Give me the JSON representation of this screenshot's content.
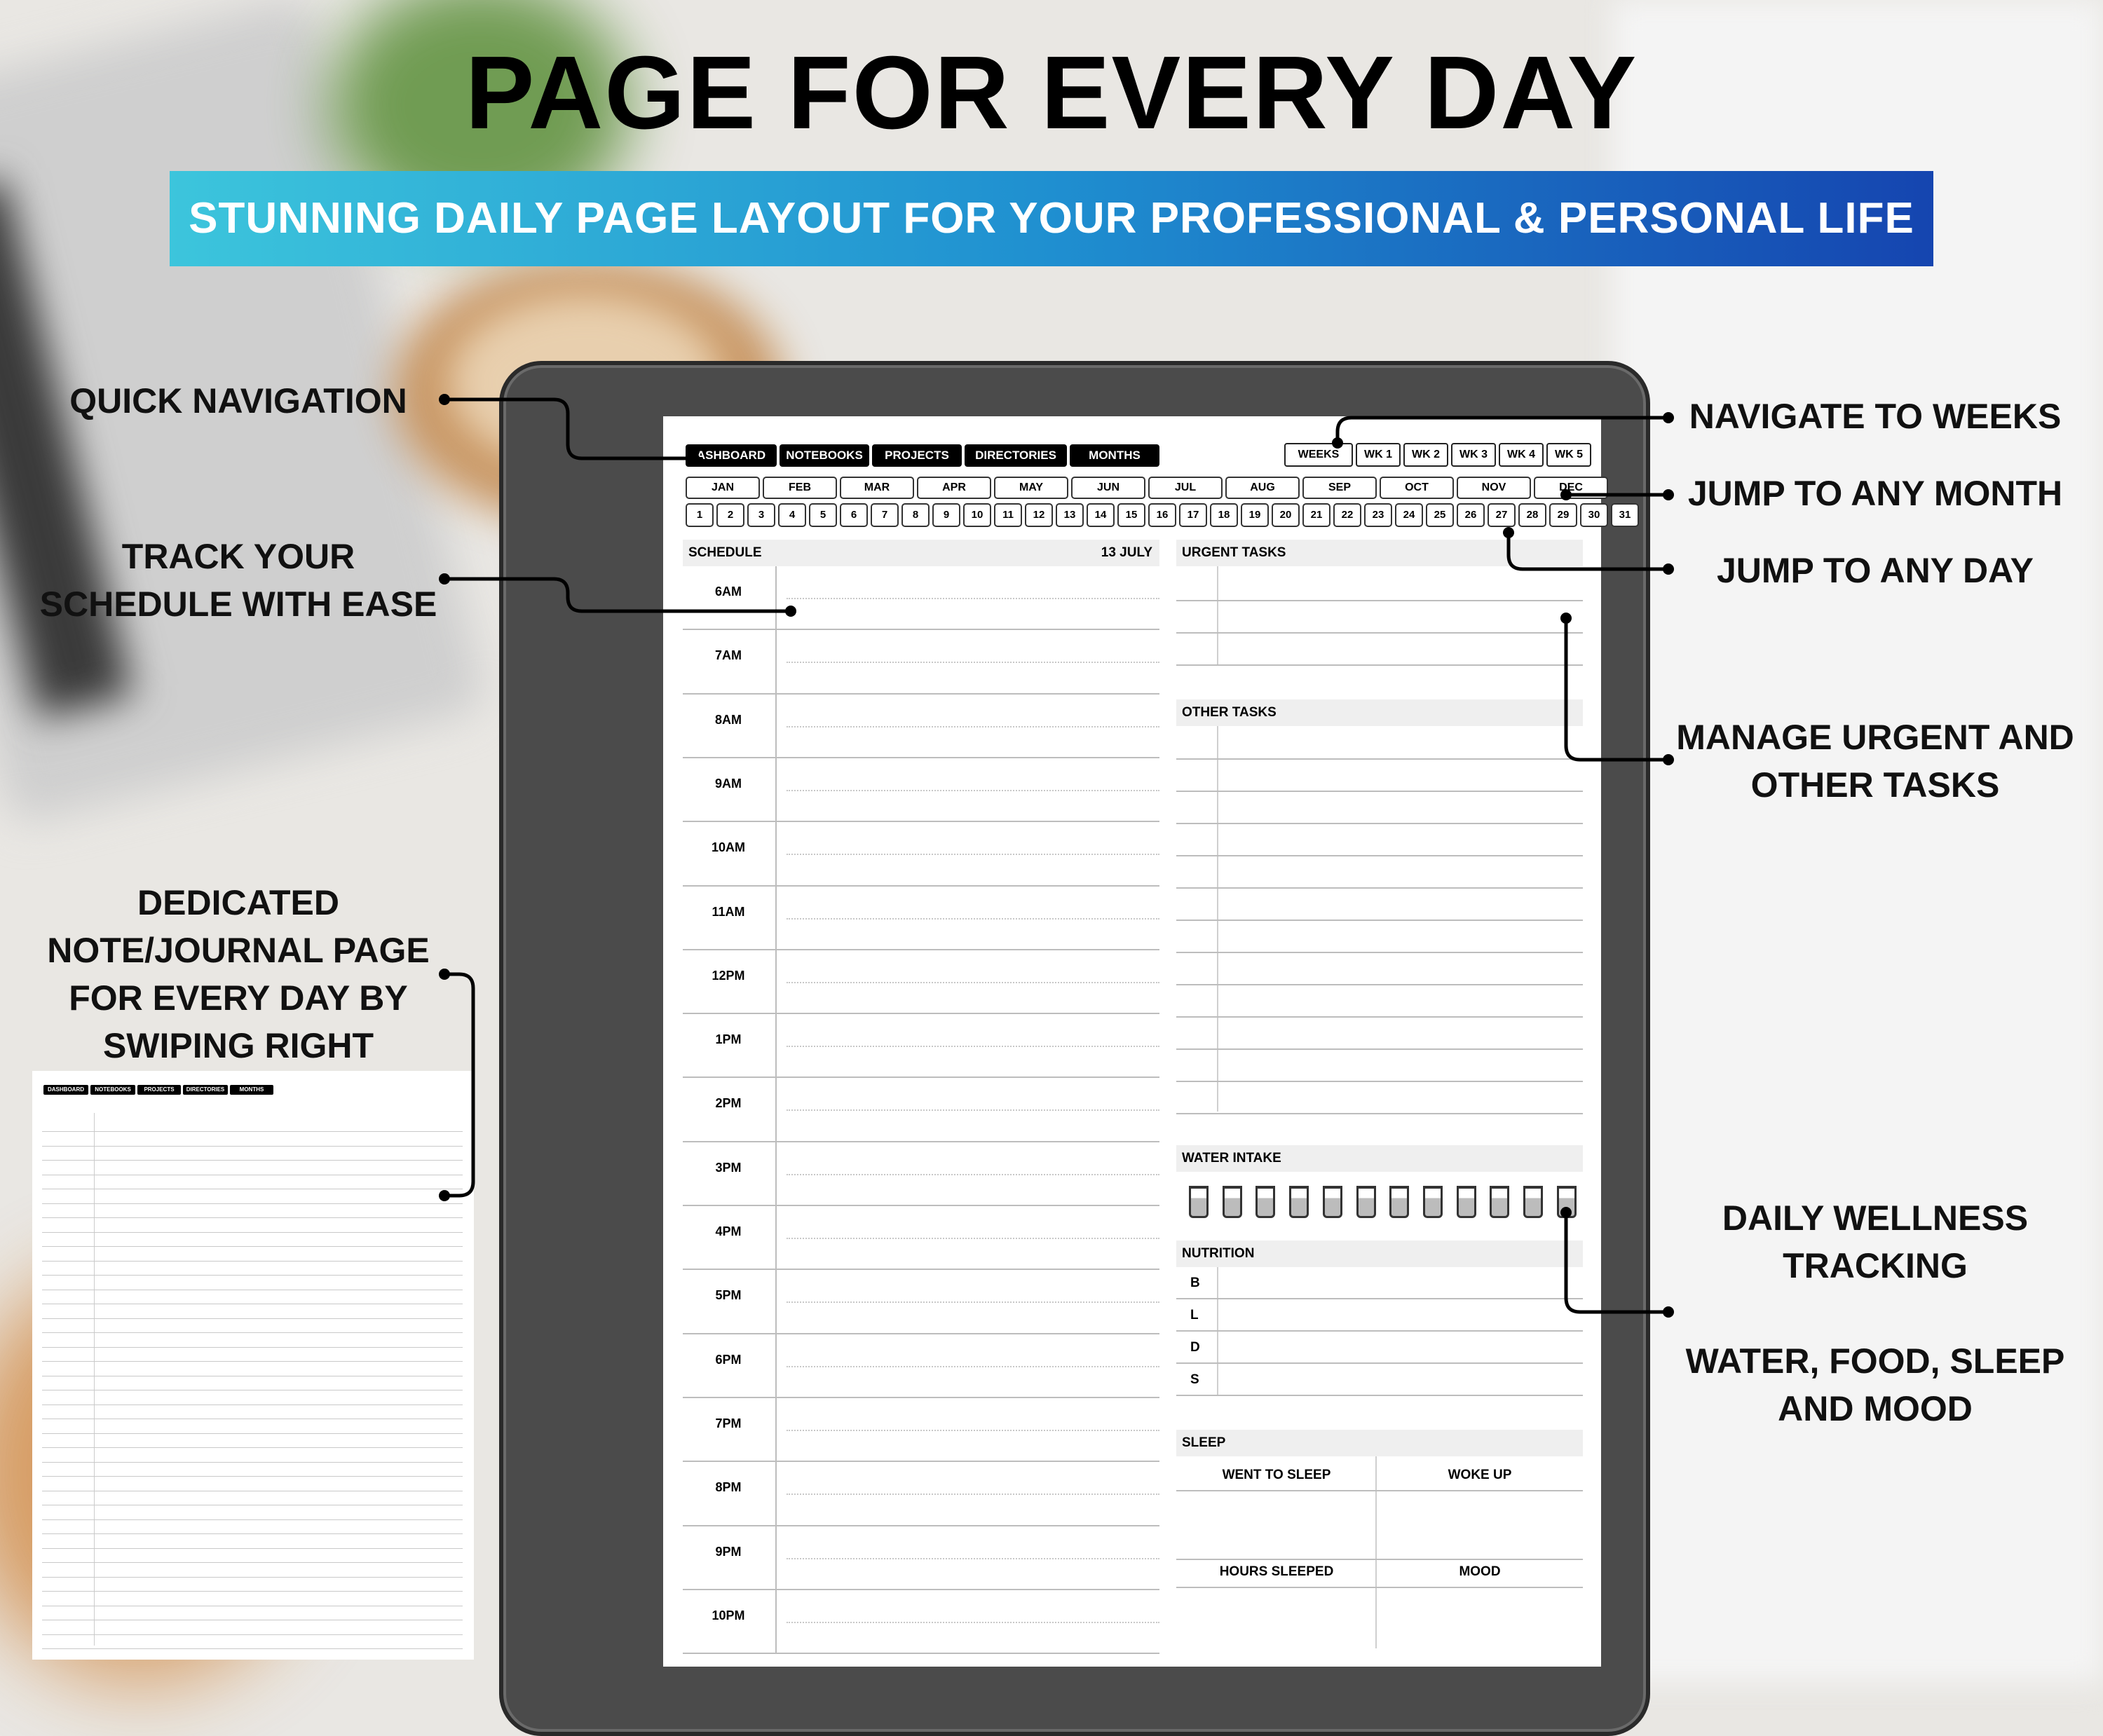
{
  "title": "PAGE FOR EVERY DAY",
  "banner": "STUNNING DAILY PAGE LAYOUT FOR YOUR PROFESSIONAL & PERSONAL LIFE",
  "callouts": {
    "quick_navigation": "QUICK NAVIGATION",
    "track_schedule_1": "TRACK YOUR",
    "track_schedule_2": "SCHEDULE WITH EASE",
    "journal_1": "DEDICATED",
    "journal_2": "NOTE/JOURNAL PAGE",
    "journal_3": "FOR EVERY DAY BY",
    "journal_4": "SWIPING RIGHT",
    "navigate_weeks": "NAVIGATE TO WEEKS",
    "jump_month": "JUMP TO ANY MONTH",
    "jump_day": "JUMP TO ANY DAY",
    "manage_tasks_1": "MANAGE URGENT AND",
    "manage_tasks_2": "OTHER TASKS",
    "wellness_1": "DAILY WELLNESS",
    "wellness_2": "TRACKING",
    "water_1": "WATER, FOOD, SLEEP",
    "water_2": "AND MOOD"
  },
  "nav_tabs": [
    "ASHBOARD",
    "NOTEBOOKS",
    "PROJECTS",
    "DIRECTORIES",
    "MONTHS"
  ],
  "week_tabs": [
    "WEEKS",
    "WK 1",
    "WK 2",
    "WK 3",
    "WK 4",
    "WK 5"
  ],
  "months": [
    "JAN",
    "FEB",
    "MAR",
    "APR",
    "MAY",
    "JUN",
    "JUL",
    "AUG",
    "SEP",
    "OCT",
    "NOV",
    "DEC"
  ],
  "days": [
    "1",
    "2",
    "3",
    "4",
    "5",
    "6",
    "7",
    "8",
    "9",
    "10",
    "11",
    "12",
    "13",
    "14",
    "15",
    "16",
    "17",
    "18",
    "19",
    "20",
    "21",
    "22",
    "23",
    "24",
    "25",
    "26",
    "27",
    "28",
    "29",
    "30",
    "31"
  ],
  "schedule": {
    "header": "SCHEDULE",
    "date": "13 JULY",
    "hours": [
      "6AM",
      "7AM",
      "8AM",
      "9AM",
      "10AM",
      "11AM",
      "12PM",
      "1PM",
      "2PM",
      "3PM",
      "4PM",
      "5PM",
      "6PM",
      "7PM",
      "8PM",
      "9PM",
      "10PM"
    ]
  },
  "urgent_tasks": "URGENT TASKS",
  "other_tasks": "OTHER TASKS",
  "water_intake": {
    "header": "WATER INTAKE",
    "glasses": 12
  },
  "nutrition": {
    "header": "NUTRITION",
    "rows": [
      "B",
      "L",
      "D",
      "S"
    ]
  },
  "sleep": {
    "header": "SLEEP",
    "went_to_sleep": "WENT TO SLEEP",
    "woke_up": "WOKE UP",
    "hours_sleeped": "HOURS SLEEPED",
    "mood": "MOOD"
  },
  "journal_tabs": [
    "DASHBOARD",
    "NOTEBOOKS",
    "PROJECTS",
    "DIRECTORIES",
    "MONTHS"
  ]
}
